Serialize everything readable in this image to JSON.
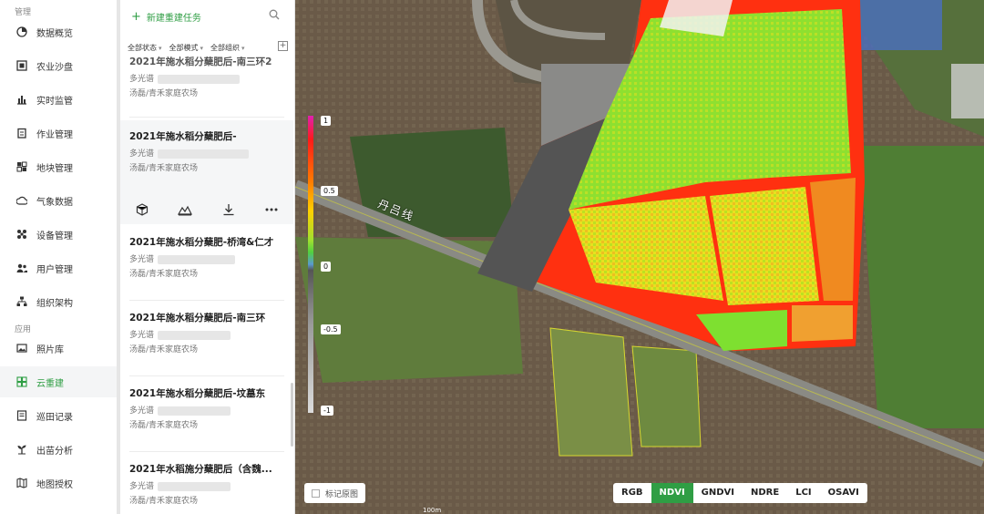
{
  "sidebar": {
    "section_manage": "管理",
    "section_apps": "应用",
    "items": [
      {
        "label": "数据概览",
        "icon": "dashboard-icon"
      },
      {
        "label": "农业沙盘",
        "icon": "sandbox-icon"
      },
      {
        "label": "实时监管",
        "icon": "bar-chart-icon"
      },
      {
        "label": "作业管理",
        "icon": "clipboard-icon"
      },
      {
        "label": "地块管理",
        "icon": "field-grid-icon"
      },
      {
        "label": "气象数据",
        "icon": "weather-icon"
      },
      {
        "label": "设备管理",
        "icon": "device-icon"
      },
      {
        "label": "用户管理",
        "icon": "users-icon"
      },
      {
        "label": "组织架构",
        "icon": "org-chart-icon"
      },
      {
        "label": "照片库",
        "icon": "photo-icon"
      },
      {
        "label": "云重建",
        "icon": "cloud-rebuild-icon",
        "active": true
      },
      {
        "label": "巡田记录",
        "icon": "record-icon"
      },
      {
        "label": "出苗分析",
        "icon": "seedling-icon"
      },
      {
        "label": "地图授权",
        "icon": "map-auth-icon"
      }
    ]
  },
  "panel": {
    "new_task": "新建重建任务",
    "filters": [
      "全部状态",
      "全部模式",
      "全部组织"
    ],
    "tasks": [
      {
        "title": "2021年施水稻分蘖肥后-南三环2",
        "mode": "多光谱",
        "farm": "汤磊/青禾家庭农场"
      },
      {
        "title": "2021年施水稻分蘖肥后-",
        "mode": "多光谱",
        "farm": "汤磊/青禾家庭农场"
      },
      {
        "title": "2021年施水稻分蘖肥-桥湾&仁才",
        "mode": "多光谱",
        "farm": "汤磊/青禾家庭农场"
      },
      {
        "title": "2021年施水稻分蘖肥后-南三环",
        "mode": "多光谱",
        "farm": "汤磊/青禾家庭农场"
      },
      {
        "title": "2021年施水稻分蘖肥后-坟墓东",
        "mode": "多光谱",
        "farm": "汤磊/青禾家庭农场"
      },
      {
        "title": "2021年水稻施分蘖肥后（含魏...",
        "mode": "多光谱",
        "farm": "汤磊/青禾家庭农场"
      }
    ]
  },
  "map": {
    "road_label": "丹吕线",
    "legend_ticks": [
      "1",
      "0.5",
      "0",
      "-0.5",
      "-1"
    ],
    "layer_toggle": "标记原图",
    "indices": [
      "RGB",
      "NDVI",
      "GNDVI",
      "NDRE",
      "LCI",
      "OSAVI"
    ],
    "active_index": "NDVI",
    "scale": "100m",
    "colors": {
      "accent": "#2f9e44"
    }
  }
}
